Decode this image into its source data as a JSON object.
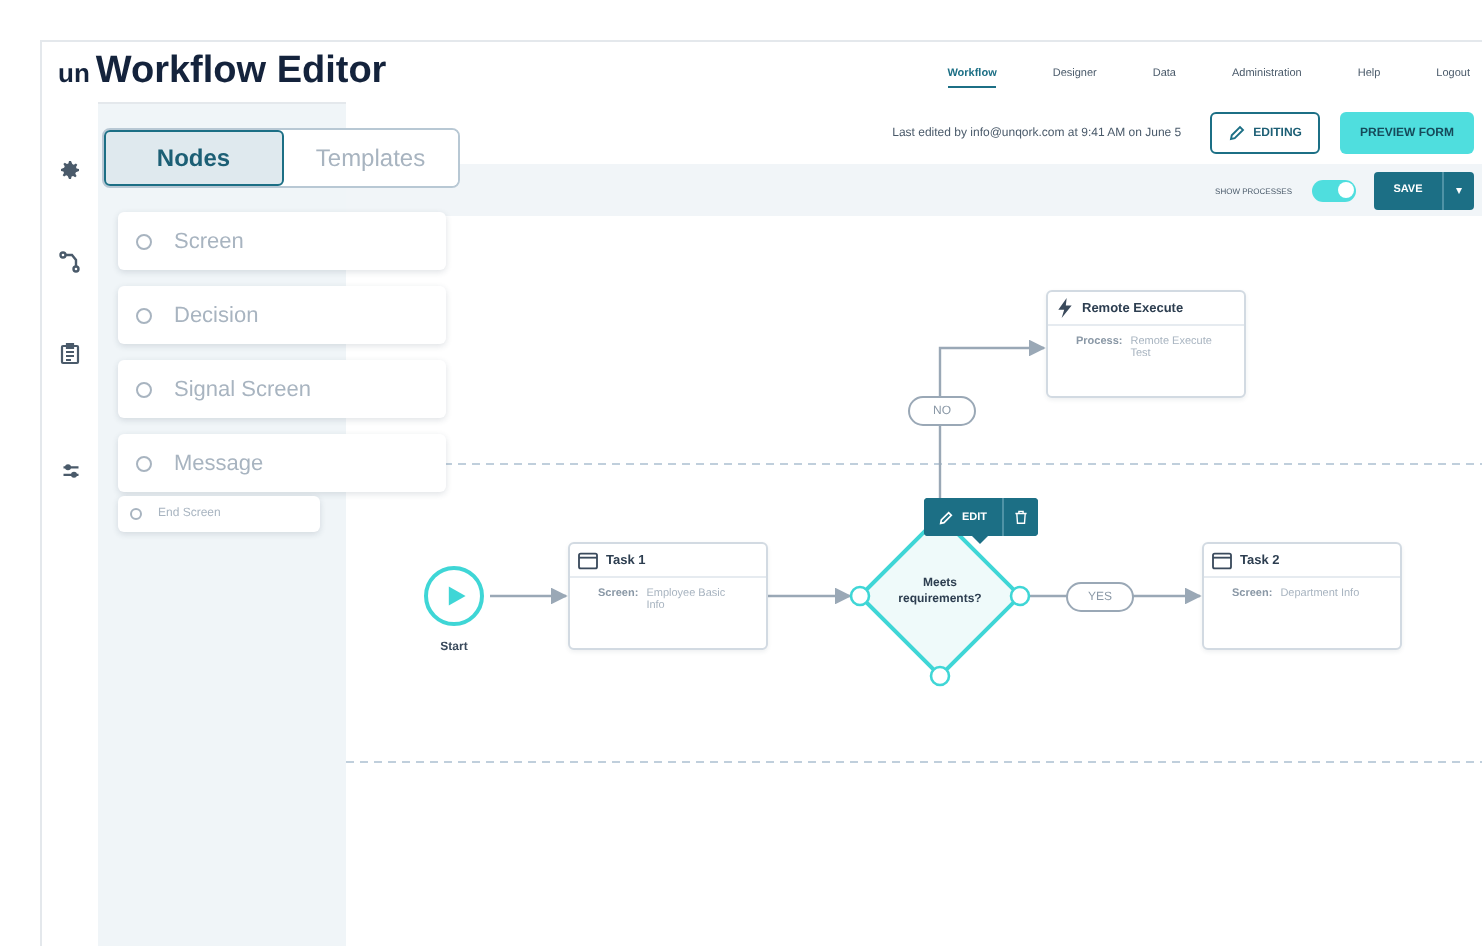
{
  "header": {
    "logo": "un",
    "title": "Workflow Editor",
    "nav": [
      {
        "label": "Workflow",
        "selected": true
      },
      {
        "label": "Designer",
        "selected": false
      },
      {
        "label": "Data",
        "selected": false
      },
      {
        "label": "Administration",
        "selected": false
      },
      {
        "label": "Help",
        "selected": false
      },
      {
        "label": "Logout",
        "selected": false
      }
    ]
  },
  "toolbar": {
    "last_edited": "Last edited by info@unqork.com at 9:41 AM on June 5",
    "editing_button": "EDITING",
    "preview_button": "PREVIEW FORM"
  },
  "bar": {
    "show_processes_label": "SHOW PROCESSES",
    "show_processes_on": true,
    "save_button": "SAVE",
    "save_menu": "▾"
  },
  "palette": {
    "tabs": [
      {
        "label": "Nodes",
        "selected": true
      },
      {
        "label": "Templates",
        "selected": false
      }
    ],
    "items": [
      {
        "label": "Screen"
      },
      {
        "label": "Decision"
      },
      {
        "label": "Signal Screen"
      },
      {
        "label": "Message"
      },
      {
        "label": "End Screen"
      }
    ]
  },
  "canvas": {
    "nodes": [
      {
        "kind": "start",
        "label": "Start"
      },
      {
        "kind": "task",
        "title": "Task 1",
        "field": "Screen:",
        "value": "Employee Basic Info"
      },
      {
        "kind": "decision",
        "label": "Meets requirements?",
        "selected": true
      },
      {
        "kind": "task",
        "title": "Task 2",
        "field": "Screen:",
        "value": "Department Info"
      },
      {
        "kind": "process",
        "title": "Remote Execute",
        "field": "Process:",
        "value": "Remote Execute Test"
      }
    ],
    "edge_labels": [
      {
        "text": "NO"
      },
      {
        "text": "YES"
      }
    ],
    "edit_button": "EDIT"
  }
}
